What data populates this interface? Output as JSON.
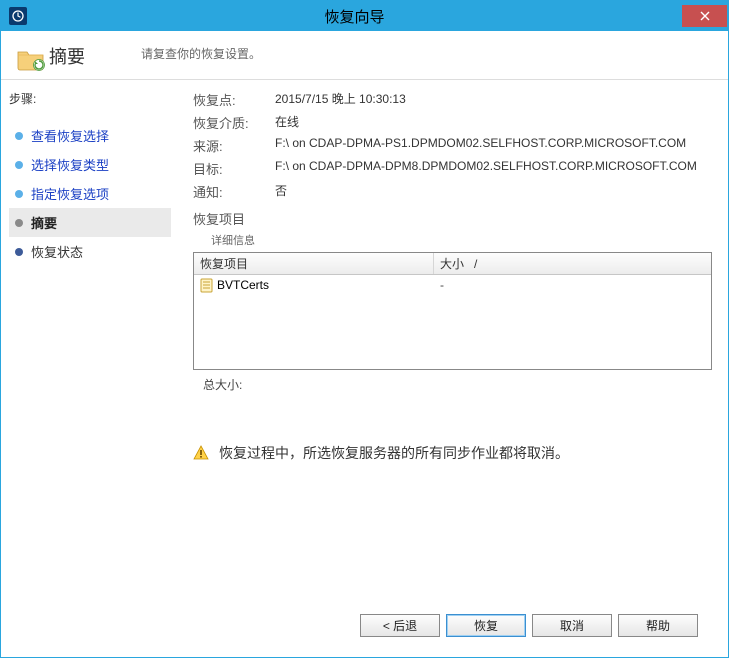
{
  "window": {
    "title": "恢复向导"
  },
  "header": {
    "heading": "摘要",
    "subheading": "请复查你的恢复设置。"
  },
  "sidebar": {
    "steps_label": "步骤:",
    "items": [
      {
        "label": "查看恢复选择",
        "state": "done",
        "link": true
      },
      {
        "label": "选择恢复类型",
        "state": "done",
        "link": true
      },
      {
        "label": "指定恢复选项",
        "state": "done",
        "link": true
      },
      {
        "label": "摘要",
        "state": "active",
        "link": false
      },
      {
        "label": "恢复状态",
        "state": "todo",
        "link": false
      }
    ]
  },
  "content": {
    "recovery_point_label": "恢复点:",
    "recovery_point_value": "2015/7/15 晚上 10:30:13",
    "media_label": "恢复介质:",
    "media_value": "在线",
    "source_label": "来源:",
    "source_value": "F:\\ on CDAP-DPMA-PS1.DPMDOM02.SELFHOST.CORP.MICROSOFT.COM",
    "target_label": "目标:",
    "target_value": "F:\\ on CDAP-DPMA-DPM8.DPMDOM02.SELFHOST.CORP.MICROSOFT.COM",
    "notify_label": "通知:",
    "notify_value": "否",
    "items_label": "恢复项目",
    "details_label": "详细信息",
    "table": {
      "col1": "恢复项目",
      "col2": "大小",
      "sort_indicator": "/",
      "rows": [
        {
          "name": "BVTCerts",
          "size": "-"
        }
      ]
    },
    "total_label": "总大小:",
    "total_value": "",
    "warning": "恢复过程中，所选恢复服务器的所有同步作业都将取消。"
  },
  "footer": {
    "back": "< 后退",
    "recover": "恢复",
    "cancel": "取消",
    "help": "帮助"
  }
}
